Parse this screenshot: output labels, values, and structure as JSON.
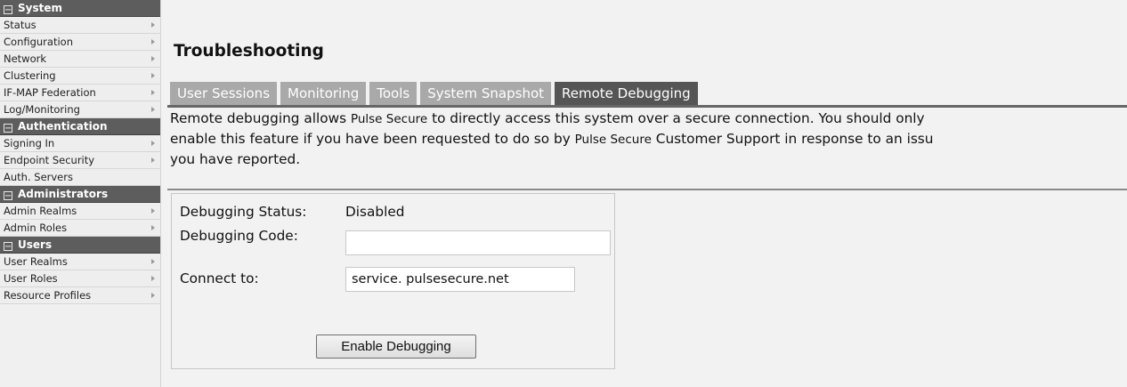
{
  "sidebar": {
    "sections": [
      {
        "title": "System",
        "items": [
          {
            "label": "Status",
            "arrow": true
          },
          {
            "label": "Configuration",
            "arrow": true
          },
          {
            "label": "Network",
            "arrow": true
          },
          {
            "label": "Clustering",
            "arrow": true
          },
          {
            "label": "IF-MAP Federation",
            "arrow": true
          },
          {
            "label": "Log/Monitoring",
            "arrow": true
          }
        ]
      },
      {
        "title": "Authentication",
        "items": [
          {
            "label": "Signing In",
            "arrow": true
          },
          {
            "label": "Endpoint Security",
            "arrow": true
          },
          {
            "label": "Auth. Servers",
            "arrow": false
          }
        ]
      },
      {
        "title": "Administrators",
        "items": [
          {
            "label": "Admin Realms",
            "arrow": true
          },
          {
            "label": "Admin Roles",
            "arrow": true
          }
        ]
      },
      {
        "title": "Users",
        "items": [
          {
            "label": "User Realms",
            "arrow": true
          },
          {
            "label": "User Roles",
            "arrow": true
          },
          {
            "label": "Resource Profiles",
            "arrow": true
          }
        ]
      }
    ]
  },
  "page": {
    "title": "Troubleshooting"
  },
  "tabs": [
    {
      "label": "User Sessions",
      "active": false
    },
    {
      "label": "Monitoring",
      "active": false
    },
    {
      "label": "Tools",
      "active": false
    },
    {
      "label": "System Snapshot",
      "active": false
    },
    {
      "label": "Remote Debugging",
      "active": true
    }
  ],
  "intro": {
    "line1_a": "Remote debugging allows ",
    "brand1": "Pulse Secure",
    "line1_b": " to directly access this system over a secure connection. You should only",
    "line2_a": "enable this feature if you have been requested to do so by ",
    "brand2": "Pulse Secure",
    "line2_b": " Customer Support in response to an issu",
    "line3": "you have reported."
  },
  "form": {
    "status_label": "Debugging Status:",
    "status_value": "Disabled",
    "code_label": "Debugging Code:",
    "code_value": "",
    "connect_label": "Connect to:",
    "connect_value": "service. pulsesecure.net",
    "enable_button": "Enable Debugging"
  }
}
